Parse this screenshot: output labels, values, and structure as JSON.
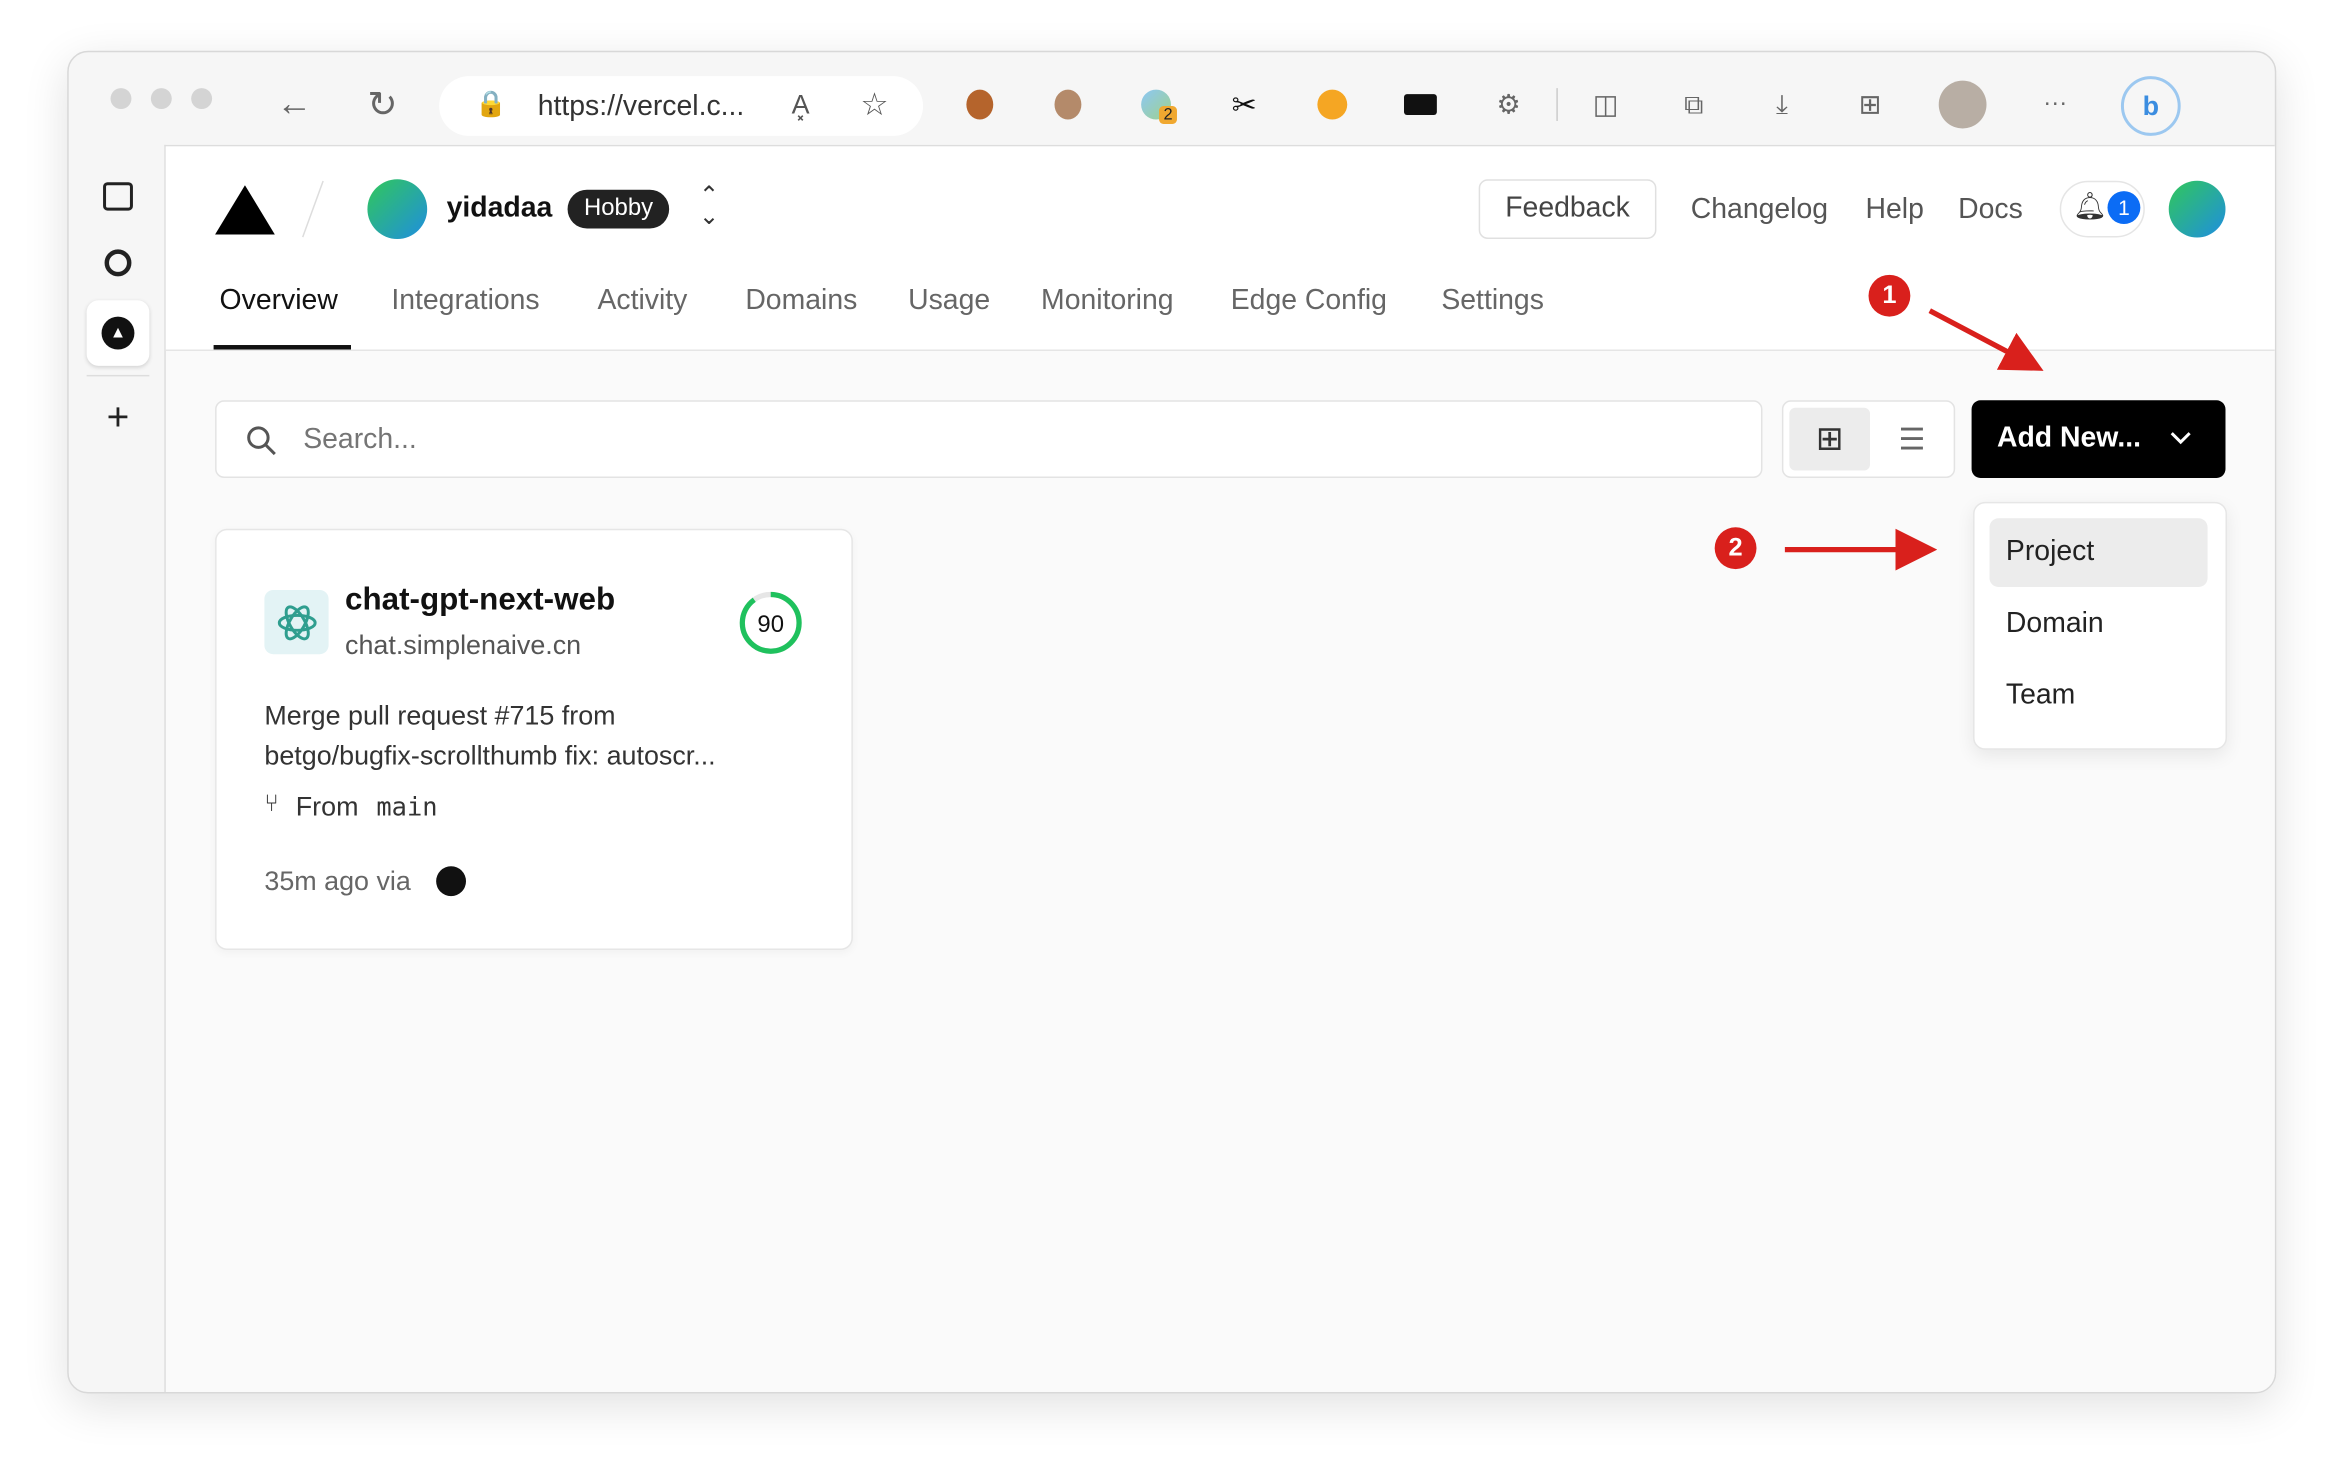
{
  "browser": {
    "url": "https://vercel.c...",
    "read_aloud_label": "A͓",
    "extension_badge": "2",
    "more_label": "···"
  },
  "header": {
    "account_name": "yidadaa",
    "plan_badge": "Hobby",
    "feedback": "Feedback",
    "changelog": "Changelog",
    "help": "Help",
    "docs": "Docs",
    "notification_count": "1"
  },
  "tabs": [
    {
      "label": "Overview",
      "active": true
    },
    {
      "label": "Integrations"
    },
    {
      "label": "Activity"
    },
    {
      "label": "Domains"
    },
    {
      "label": "Usage"
    },
    {
      "label": "Monitoring"
    },
    {
      "label": "Edge Config"
    },
    {
      "label": "Settings"
    }
  ],
  "search": {
    "placeholder": "Search..."
  },
  "add_new": {
    "label": "Add New...",
    "menu": [
      "Project",
      "Domain",
      "Team"
    ]
  },
  "project_card": {
    "name": "chat-gpt-next-web",
    "domain": "chat.simplenaive.cn",
    "score": "90",
    "score_value": 90,
    "commit_line1": "Merge pull request #715 from",
    "commit_line2": "betgo/bugfix-scrollthumb fix: autoscr...",
    "from_label": "From",
    "branch": "main",
    "time": "35m ago via"
  },
  "annotations": {
    "step1": "1",
    "step2": "2",
    "color": "#d9201c"
  },
  "colors": {
    "accent": "#000000",
    "score_green": "#1fc15d",
    "notification_blue": "#0b6cf5"
  }
}
